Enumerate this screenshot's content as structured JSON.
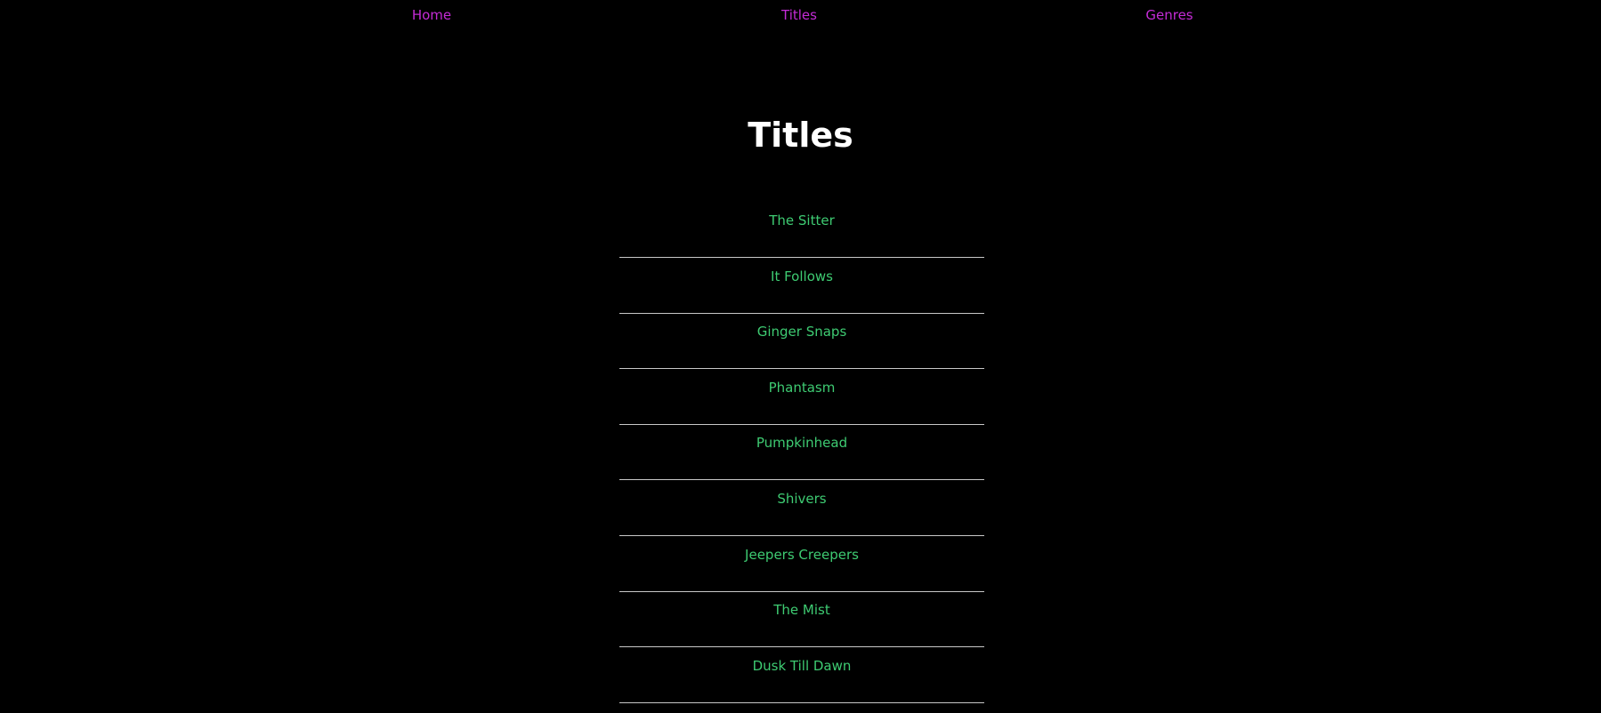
{
  "nav": {
    "home": "Home",
    "titles": "Titles",
    "genres": "Genres"
  },
  "page": {
    "title": "Titles"
  },
  "titles": [
    "The Sitter",
    "It Follows",
    "Ginger Snaps",
    "Phantasm",
    "Pumpkinhead",
    "Shivers",
    "Jeepers Creepers",
    "The Mist",
    "Dusk Till Dawn"
  ],
  "colors": {
    "background": "#000000",
    "nav_link": "#c42bd6",
    "title_link": "#3ecb72",
    "heading": "#ffffff",
    "divider": "#c8c8c8"
  }
}
